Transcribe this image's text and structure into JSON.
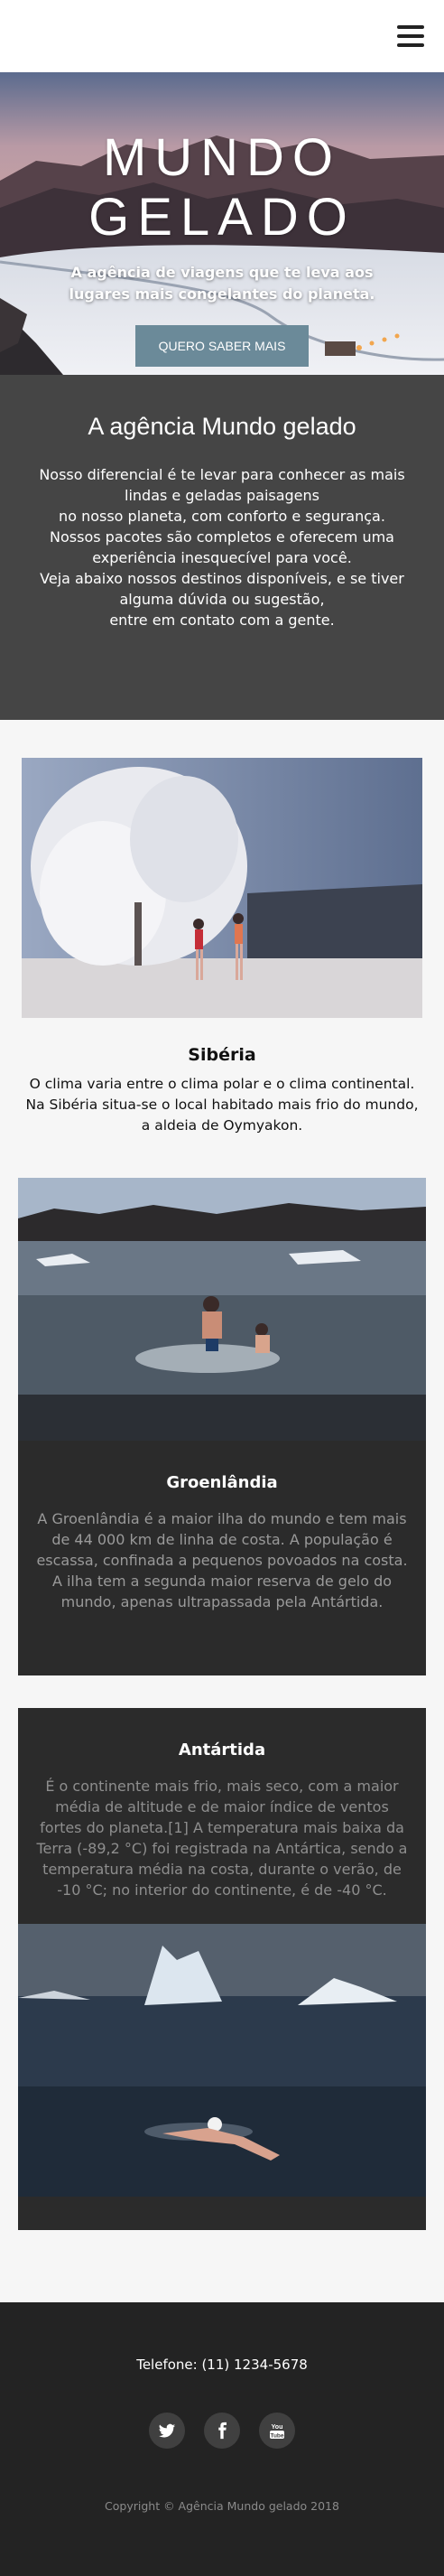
{
  "header": {
    "menu_icon": "hamburger-menu-icon"
  },
  "hero": {
    "title_line1": "MUNDO",
    "title_line2": "GELADO",
    "subtitle": "A agência de viagens que te leva aos lugares mais congelantes do planeta.",
    "button_label": "QUERO SABER MAIS",
    "button_color": "#6b8a99"
  },
  "about": {
    "title": "A agência Mundo gelado",
    "lines": [
      "Nosso diferencial é te levar para conhecer as mais lindas e geladas paisagens",
      "no nosso planeta, com conforto e segurança.",
      "Nossos pacotes são completos e oferecem uma experiência inesquecível para você.",
      "Veja abaixo nossos destinos disponíveis, e se tiver alguma dúvida ou sugestão,",
      "entre em contato com a gente."
    ]
  },
  "destinations": {
    "siberia": {
      "title": "Sibéria",
      "text": "O clima varia entre o clima polar e o clima continental. Na Sibéria situa-se o local habitado mais frio do mundo, a aldeia de Oymyakon."
    },
    "greenland": {
      "title": "Groenlândia",
      "text": "A Groenlândia é a maior ilha do mundo e tem mais de 44 000 km de linha de costa. A população é escassa, confinada a pequenos povoados na costa. A ilha tem a segunda maior reserva de gelo do mundo, apenas ultrapassada pela Antártida."
    },
    "antarctica": {
      "title": "Antártida",
      "text": "É o continente mais frio, mais seco, com a maior média de altitude e de maior índice de ventos fortes do planeta.[1] A temperatura mais baixa da Terra (-89,2 °C) foi registrada na Antártica, sendo a temperatura média na costa, durante o verão, de -10 °C; no interior do continente, é de -40 °C."
    }
  },
  "footer": {
    "phone": "Telefone: (11) 1234-5678",
    "social_icons": [
      "twitter-icon",
      "facebook-icon",
      "youtube-icon"
    ],
    "youtube_label": "You Tube",
    "copyright": "Copyright © Agência Mundo gelado 2018"
  }
}
